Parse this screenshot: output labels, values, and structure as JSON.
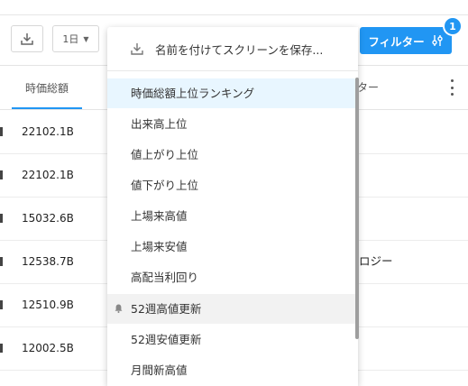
{
  "toolbar": {
    "period_label": "1日",
    "filter_label": "フィルター",
    "filter_badge": "1"
  },
  "table": {
    "header_left": "時価総額",
    "header_right": "ター",
    "rows": [
      {
        "value": "22102.1B",
        "right": ""
      },
      {
        "value": "22102.1B",
        "right": ""
      },
      {
        "value": "15032.6B",
        "right": ""
      },
      {
        "value": "12538.7B",
        "right": "ロジー"
      },
      {
        "value": "12510.9B",
        "right": ""
      },
      {
        "value": "12002.5B",
        "right": ""
      }
    ]
  },
  "dropdown": {
    "save_label": "名前を付けてスクリーンを保存...",
    "items": [
      {
        "label": "時価総額上位ランキング",
        "state": "active"
      },
      {
        "label": "出来高上位",
        "state": ""
      },
      {
        "label": "値上がり上位",
        "state": ""
      },
      {
        "label": "値下がり上位",
        "state": ""
      },
      {
        "label": "上場来高値",
        "state": ""
      },
      {
        "label": "上場来安値",
        "state": ""
      },
      {
        "label": "高配当利回り",
        "state": ""
      },
      {
        "label": "52週高値更新",
        "state": "hover"
      },
      {
        "label": "52週安値更新",
        "state": ""
      },
      {
        "label": "月間新高値",
        "state": ""
      }
    ]
  },
  "colors": {
    "accent": "#2196f3",
    "active_bg": "#e8f6ff"
  }
}
